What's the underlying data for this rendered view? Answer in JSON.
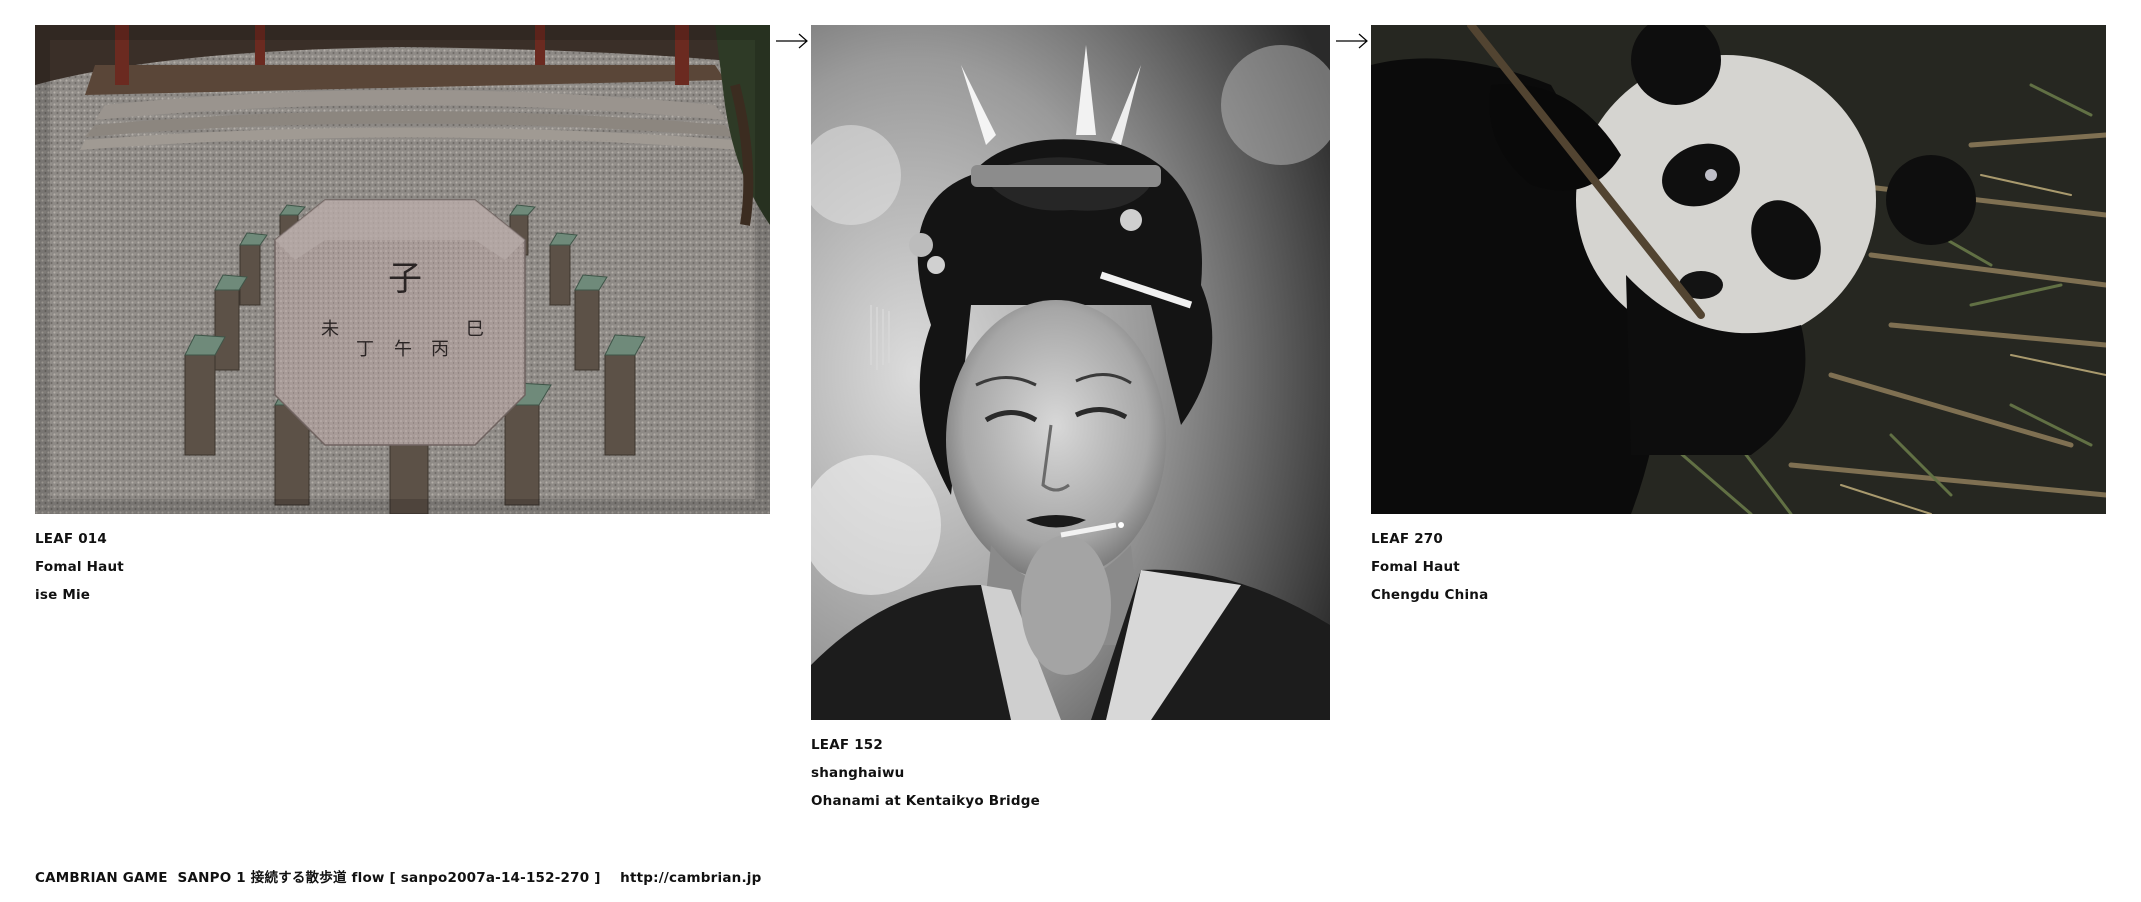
{
  "leaves": [
    {
      "leaf_id": "LEAF 014",
      "author": "Fomal Haut",
      "location": "ise Mie"
    },
    {
      "leaf_id": "LEAF 152",
      "author": "shanghaiwu",
      "location": "Ohanami at Kentaikyo Bridge"
    },
    {
      "leaf_id": "LEAF 270",
      "author": "Fomal Haut",
      "location": "Chengdu China"
    }
  ],
  "stone_characters": [
    "子",
    "午",
    "丙",
    "丁",
    "巳",
    "未"
  ],
  "arrows": [
    "right-arrow-icon",
    "right-arrow-icon"
  ],
  "footer": {
    "text": "CAMBRIAN GAME  SANPO 1 接続する散歩道 flow [ sanpo2007a-14-152-270 ]    http://cambrian.jp"
  }
}
